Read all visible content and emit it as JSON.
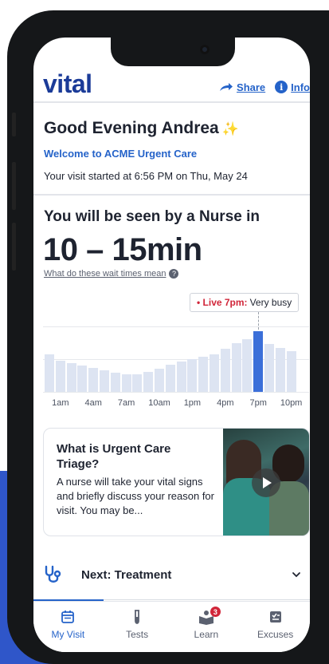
{
  "header": {
    "logo": "vital",
    "share_label": "Share",
    "info_label": "Info"
  },
  "greeting": {
    "title": "Good Evening Andrea",
    "welcome": "Welcome to ACME Urgent Care",
    "visit_started": "Your visit started at 6:56 PM on Thu, May 24"
  },
  "wait": {
    "heading": "You will be seen by a Nurse in",
    "estimate": "10 – 15min",
    "explain_link": "What do these wait times mean"
  },
  "chart_data": {
    "type": "bar",
    "categories": [
      "12am",
      "1am",
      "2am",
      "3am",
      "4am",
      "5am",
      "6am",
      "7am",
      "8am",
      "9am",
      "10am",
      "11am",
      "12pm",
      "1pm",
      "2pm",
      "3pm",
      "4pm",
      "5pm",
      "6pm",
      "7pm",
      "8pm",
      "9pm",
      "10pm"
    ],
    "values": [
      57,
      48,
      44,
      40,
      37,
      33,
      29,
      27,
      27,
      30,
      35,
      41,
      46,
      50,
      54,
      57,
      66,
      74,
      81,
      93,
      73,
      67,
      62
    ],
    "ylim": [
      0,
      100
    ],
    "highlight_index": 19,
    "tooltip": {
      "live": "• Live 7pm:",
      "status": "Very busy"
    },
    "tick_labels": [
      "1am",
      "4am",
      "7am",
      "10am",
      "1pm",
      "4pm",
      "7pm",
      "10pm"
    ],
    "tick_indices": [
      1,
      4,
      7,
      10,
      13,
      16,
      19,
      22
    ],
    "colors": {
      "bar": "#dde4f2",
      "active": "#3b6fd9"
    }
  },
  "card": {
    "title": "What is Urgent Care Triage?",
    "text": "A nurse will take your vital signs and briefly discuss your reason for visit. You may be..."
  },
  "next": {
    "label": "Next: Treatment"
  },
  "tabbar": {
    "tabs": [
      "My Visit",
      "Tests",
      "Learn",
      "Excuses"
    ],
    "learn_badge": "3",
    "active": "My Visit"
  },
  "colors": {
    "brand": "#1b3b98",
    "link": "#2563c9",
    "alert": "#d1263a"
  }
}
